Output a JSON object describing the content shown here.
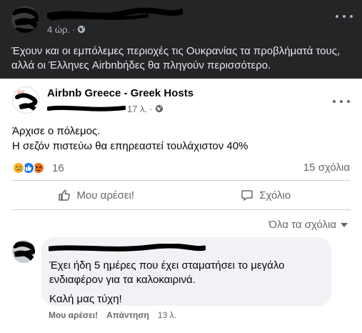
{
  "post": {
    "time": "4 ώρ.",
    "text": "Έχουν και οι εμπόλεμες περιοχές τις Ουκρανίας τα προβλήματά τους, αλλά οι Έλληνες Airbnbήδες θα πληγούν περισσότερο."
  },
  "shared": {
    "page_name": "Airbnb Greece - Greek Hosts",
    "time": "17 λ.",
    "text_line1": "Άρχισε ο πόλεμος.",
    "text_line2": "Η σεζόν πιστεύω θα επηρεαστεί τουλάχιστον 40%",
    "reactions_count": "16",
    "comments_count": "15 σχόλια",
    "like_label": "Μου αρέσει!",
    "comment_label": "Σχόλιο",
    "filter_label": "Όλα τα σχόλια"
  },
  "comment": {
    "text": "Έχει ήδη 5 ημέρες που έχει σταματήσει το μεγάλο ενδιαφέρον για τα καλοκαιρινά.",
    "text2": "Καλή μας τύχη!",
    "like_label": "Μου αρέσει!",
    "reply_label": "Απάντηση",
    "time": "13 λ."
  },
  "colors": {
    "dark_bg": "#242526",
    "card_bg": "#ffffff",
    "accent_like": "#1877f2"
  }
}
